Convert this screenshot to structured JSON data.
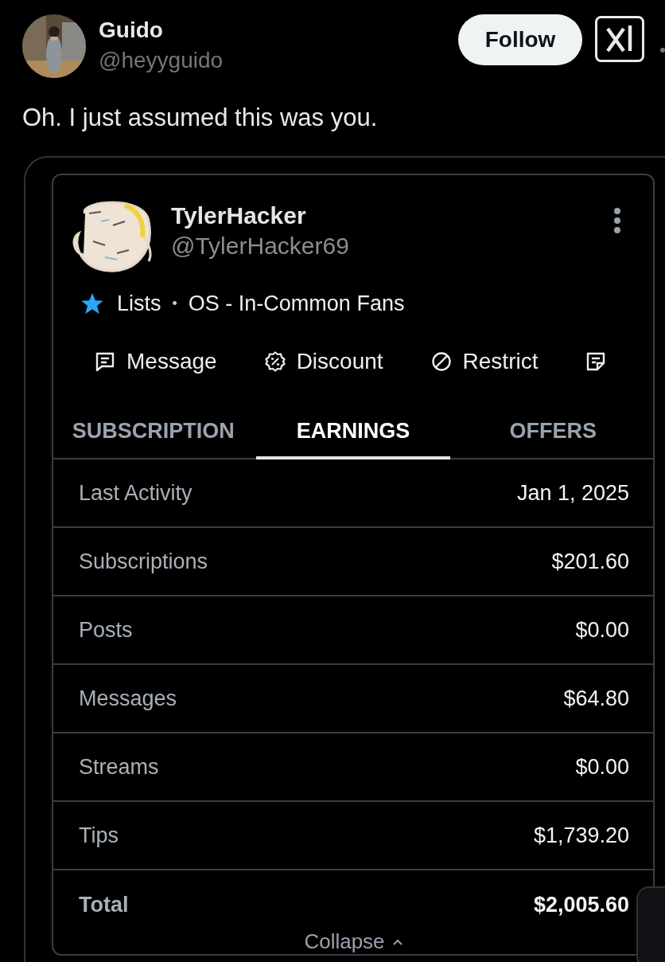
{
  "post": {
    "author": {
      "name": "Guido",
      "handle": "@heyyguido"
    },
    "follow_button": "Follow",
    "text": "Oh. I just assumed this was you."
  },
  "embedded_screenshot": {
    "profile": {
      "name": "TylerHacker",
      "handle": "@TylerHacker69"
    },
    "lists": {
      "label": "Lists",
      "separator": "•",
      "list_name": "OS - In-Common Fans"
    },
    "actions": [
      {
        "kind": "message",
        "label": "Message"
      },
      {
        "kind": "discount",
        "label": "Discount"
      },
      {
        "kind": "restrict",
        "label": "Restrict"
      },
      {
        "kind": "note"
      }
    ],
    "tabs": [
      {
        "label": "SUBSCRIPTION",
        "selected": false
      },
      {
        "label": "EARNINGS",
        "selected": true
      },
      {
        "label": "OFFERS",
        "selected": false
      }
    ],
    "rows": [
      {
        "kind": "item",
        "label": "Last Activity",
        "value": "Jan 1, 2025"
      },
      {
        "kind": "item",
        "label": "Subscriptions",
        "value": "$201.60"
      },
      {
        "kind": "item",
        "label": "Posts",
        "value": "$0.00"
      },
      {
        "kind": "item",
        "label": "Messages",
        "value": "$64.80"
      },
      {
        "kind": "item",
        "label": "Streams",
        "value": "$0.00"
      },
      {
        "kind": "item",
        "label": "Tips",
        "value": "$1,739.20"
      },
      {
        "kind": "total",
        "label": "Total",
        "value": "$2,005.60"
      }
    ],
    "collapse_link": "Collapse"
  }
}
